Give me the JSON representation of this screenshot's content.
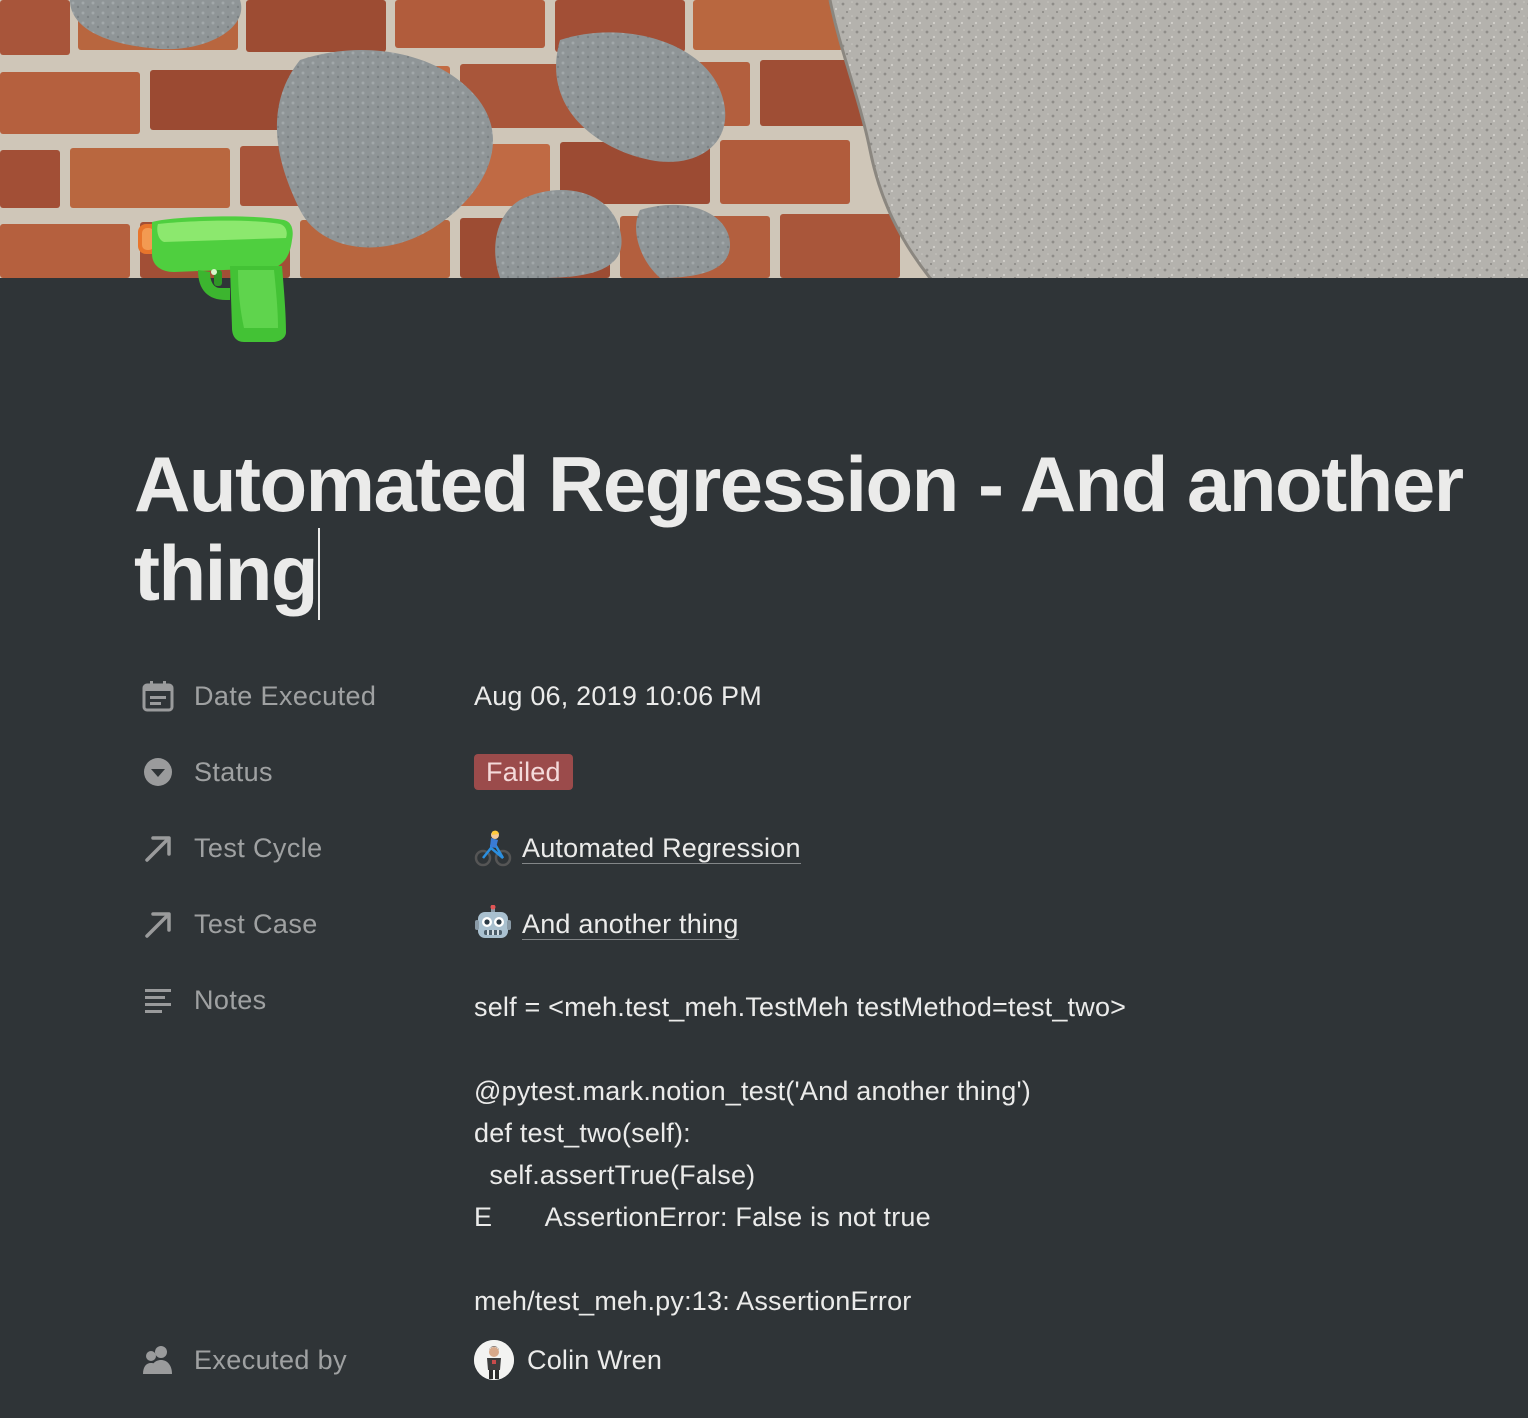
{
  "page": {
    "title": "Automated Regression - And another thing",
    "icon": "water-pistol-icon"
  },
  "properties": {
    "date_executed": {
      "label": "Date Executed",
      "icon": "calendar-icon",
      "value": "Aug 06, 2019 10:06 PM"
    },
    "status": {
      "label": "Status",
      "icon": "select-caret-icon",
      "value": "Failed",
      "color": "#9b4b4b"
    },
    "test_cycle": {
      "label": "Test Cycle",
      "icon": "relation-arrow-icon",
      "emoji": "cyclist-icon",
      "value": "Automated Regression"
    },
    "test_case": {
      "label": "Test Case",
      "icon": "relation-arrow-icon",
      "emoji": "robot-icon",
      "value": "And another thing"
    },
    "notes": {
      "label": "Notes",
      "icon": "text-lines-icon",
      "value": "self = <meh.test_meh.TestMeh testMethod=test_two>\n\n@pytest.mark.notion_test('And another thing')\ndef test_two(self):\n  self.assertTrue(False)\nE       AssertionError: False is not true\n\nmeh/test_meh.py:13: AssertionError"
    },
    "executed_by": {
      "label": "Executed by",
      "icon": "person-icon",
      "value": "Colin Wren"
    }
  },
  "colors": {
    "background": "#2f3437",
    "text": "#ebebea",
    "failed_badge": "#9b4b4b"
  }
}
